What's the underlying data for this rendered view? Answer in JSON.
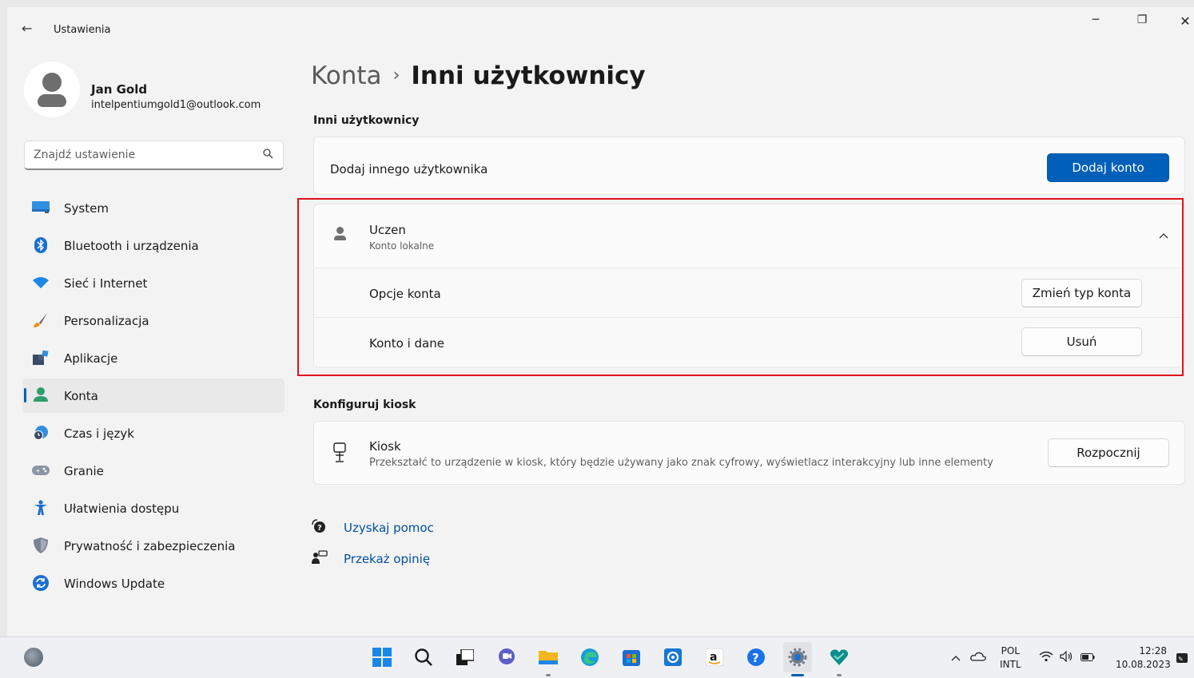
{
  "window": {
    "app_title": "Ustawienia",
    "back_icon": "←",
    "minimize_icon": "─",
    "restore_icon": "❐",
    "close_icon": "✕"
  },
  "profile": {
    "name": "Jan Gold",
    "email": "intelpentiumgold1@outlook.com"
  },
  "search": {
    "placeholder": "Znajdź ustawienie",
    "icon": "⌕"
  },
  "nav": {
    "items": [
      {
        "label": "System",
        "icon": "system-icon"
      },
      {
        "label": "Bluetooth i urządzenia",
        "icon": "bluetooth-icon"
      },
      {
        "label": "Sieć i Internet",
        "icon": "wifi-icon"
      },
      {
        "label": "Personalizacja",
        "icon": "brush-icon"
      },
      {
        "label": "Aplikacje",
        "icon": "apps-icon"
      },
      {
        "label": "Konta",
        "icon": "account-icon",
        "active": true
      },
      {
        "label": "Czas i język",
        "icon": "clock-globe-icon"
      },
      {
        "label": "Granie",
        "icon": "gamepad-icon"
      },
      {
        "label": "Ułatwienia dostępu",
        "icon": "accessibility-icon"
      },
      {
        "label": "Prywatność i zabezpieczenia",
        "icon": "shield-icon"
      },
      {
        "label": "Windows Update",
        "icon": "update-icon"
      }
    ]
  },
  "breadcrumb": {
    "parent": "Konta",
    "separator": "›",
    "current": "Inni użytkownicy"
  },
  "other_users": {
    "section_title": "Inni użytkownicy",
    "add_label": "Dodaj innego użytkownika",
    "add_button": "Dodaj konto",
    "user": {
      "name": "Uczen",
      "type": "Konto lokalne",
      "chevron": "^",
      "options_label": "Opcje konta",
      "options_button": "Zmień typ konta",
      "data_label": "Konto i dane",
      "data_button": "Usuń"
    }
  },
  "kiosk": {
    "section_title": "Konfiguruj kiosk",
    "title": "Kiosk",
    "description": "Przekształć to urządzenie w kiosk, który będzie używany jako znak cyfrowy, wyświetlacz interakcyjny lub inne elementy",
    "button": "Rozpocznij"
  },
  "links": {
    "help": "Uzyskaj pomoc",
    "feedback": "Przekaż opinię"
  },
  "taskbar": {
    "language_line1": "POL",
    "language_line2": "INTL",
    "time": "12:28",
    "date": "10.08.2023"
  },
  "colors": {
    "accent": "#005fb8",
    "highlight_box": "#e1121c"
  }
}
